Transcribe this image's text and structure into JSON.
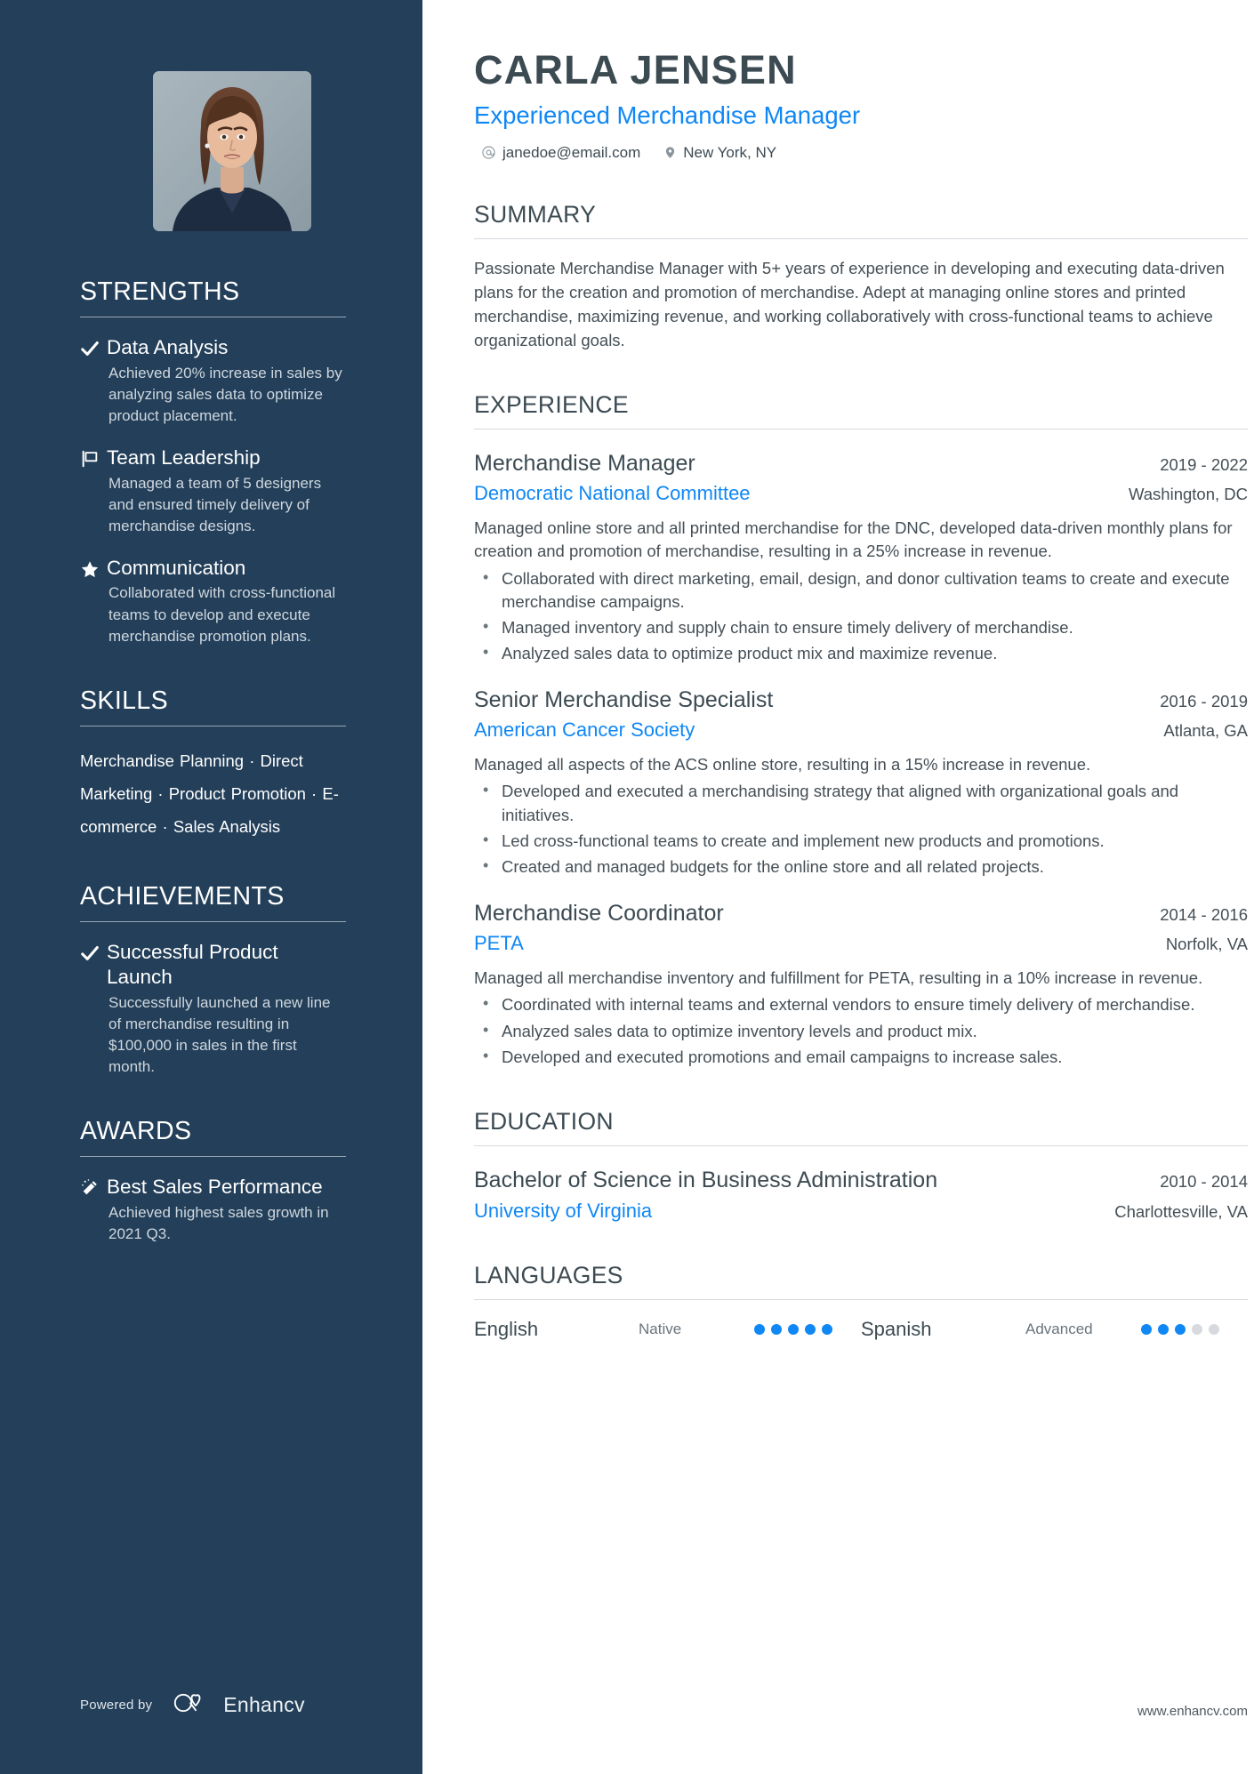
{
  "header": {
    "name": "CARLA JENSEN",
    "role": "Experienced Merchandise Manager",
    "email": "janedoe@email.com",
    "location": "New York, NY",
    "email_icon": "at-icon",
    "location_icon": "map-pin-icon"
  },
  "colors": {
    "sidebar_bg": "#233f59",
    "accent_blue": "#0f87f5",
    "heading_dark": "#3c4a52",
    "body_text": "#454f56",
    "dot_empty": "#d6dade"
  },
  "sidebar": {
    "strengths": {
      "heading": "STRENGTHS",
      "items": [
        {
          "icon": "check-icon",
          "title": "Data Analysis",
          "desc": "Achieved 20% increase in sales by analyzing sales data to optimize product placement."
        },
        {
          "icon": "flag-icon",
          "title": "Team Leadership",
          "desc": "Managed a team of 5 designers and ensured timely delivery of merchandise designs."
        },
        {
          "icon": "star-icon",
          "title": "Communication",
          "desc": "Collaborated with cross-functional teams to develop and execute merchandise promotion plans."
        }
      ]
    },
    "skills": {
      "heading": "SKILLS",
      "items": [
        "Merchandise Planning",
        "Direct Marketing",
        "Product Promotion",
        "E-commerce",
        "Sales Analysis"
      ],
      "separator": "·"
    },
    "achievements": {
      "heading": "ACHIEVEMENTS",
      "items": [
        {
          "icon": "check-icon",
          "title": "Successful Product Launch",
          "desc": "Successfully launched a new line of merchandise resulting in $100,000 in sales in the first month."
        }
      ]
    },
    "awards": {
      "heading": "AWARDS",
      "items": [
        {
          "icon": "magic-wand-icon",
          "title": "Best Sales Performance",
          "desc": "Achieved highest sales growth in 2021 Q3."
        }
      ]
    },
    "footer": {
      "powered_by": "Powered by",
      "brand": "Enhancv",
      "brand_icon": "enhancv-logo-icon"
    }
  },
  "main": {
    "summary": {
      "heading": "SUMMARY",
      "text": "Passionate Merchandise Manager with 5+ years of experience in developing and executing data-driven plans for the creation and promotion of merchandise. Adept at managing online stores and printed merchandise, maximizing revenue, and working collaboratively with cross-functional teams to achieve organizational goals."
    },
    "experience": {
      "heading": "EXPERIENCE",
      "entries": [
        {
          "title": "Merchandise Manager",
          "date": "2019 - 2022",
          "org": "Democratic National Committee",
          "location": "Washington, DC",
          "desc": "Managed online store and all printed merchandise for the DNC, developed data-driven monthly plans for creation and promotion of merchandise, resulting in a 25% increase in revenue.",
          "bullets": [
            "Collaborated with direct marketing, email, design, and donor cultivation teams to create and execute merchandise campaigns.",
            "Managed inventory and supply chain to ensure timely delivery of merchandise.",
            "Analyzed sales data to optimize product mix and maximize revenue."
          ]
        },
        {
          "title": "Senior Merchandise Specialist",
          "date": "2016 - 2019",
          "org": "American Cancer Society",
          "location": "Atlanta, GA",
          "desc": "Managed all aspects of the ACS online store, resulting in a 15% increase in revenue.",
          "bullets": [
            "Developed and executed a merchandising strategy that aligned with organizational goals and initiatives.",
            "Led cross-functional teams to create and implement new products and promotions.",
            "Created and managed budgets for the online store and all related projects."
          ]
        },
        {
          "title": "Merchandise Coordinator",
          "date": "2014 - 2016",
          "org": "PETA",
          "location": "Norfolk, VA",
          "desc": "Managed all merchandise inventory and fulfillment for PETA, resulting in a 10% increase in revenue.",
          "bullets": [
            "Coordinated with internal teams and external vendors to ensure timely delivery of merchandise.",
            "Analyzed sales data to optimize inventory levels and product mix.",
            "Developed and executed promotions and email campaigns to increase sales."
          ]
        }
      ]
    },
    "education": {
      "heading": "EDUCATION",
      "entries": [
        {
          "title": "Bachelor of Science in Business Administration",
          "date": "2010 - 2014",
          "org": "University of Virginia",
          "location": "Charlottesville, VA"
        }
      ]
    },
    "languages": {
      "heading": "LANGUAGES",
      "items": [
        {
          "name": "English",
          "level": "Native",
          "rating": 5,
          "max": 5
        },
        {
          "name": "Spanish",
          "level": "Advanced",
          "rating": 3,
          "max": 5
        }
      ]
    },
    "footer": {
      "website": "www.enhancv.com"
    }
  }
}
